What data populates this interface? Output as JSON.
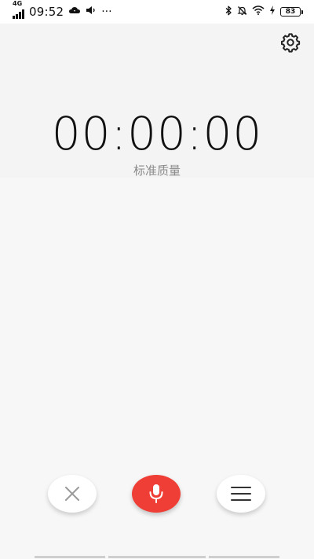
{
  "status_bar": {
    "network": "4G",
    "time": "09:52",
    "more": "···",
    "battery_level": "83"
  },
  "recorder": {
    "elapsed_time": "00:00:00",
    "quality_label": "标准质量"
  },
  "icons": {
    "settings": "gear-icon",
    "cancel": "close-icon",
    "record": "microphone-icon",
    "list": "menu-icon"
  },
  "colors": {
    "record_button": "#ef3e36",
    "background": "#f7f7f7"
  }
}
